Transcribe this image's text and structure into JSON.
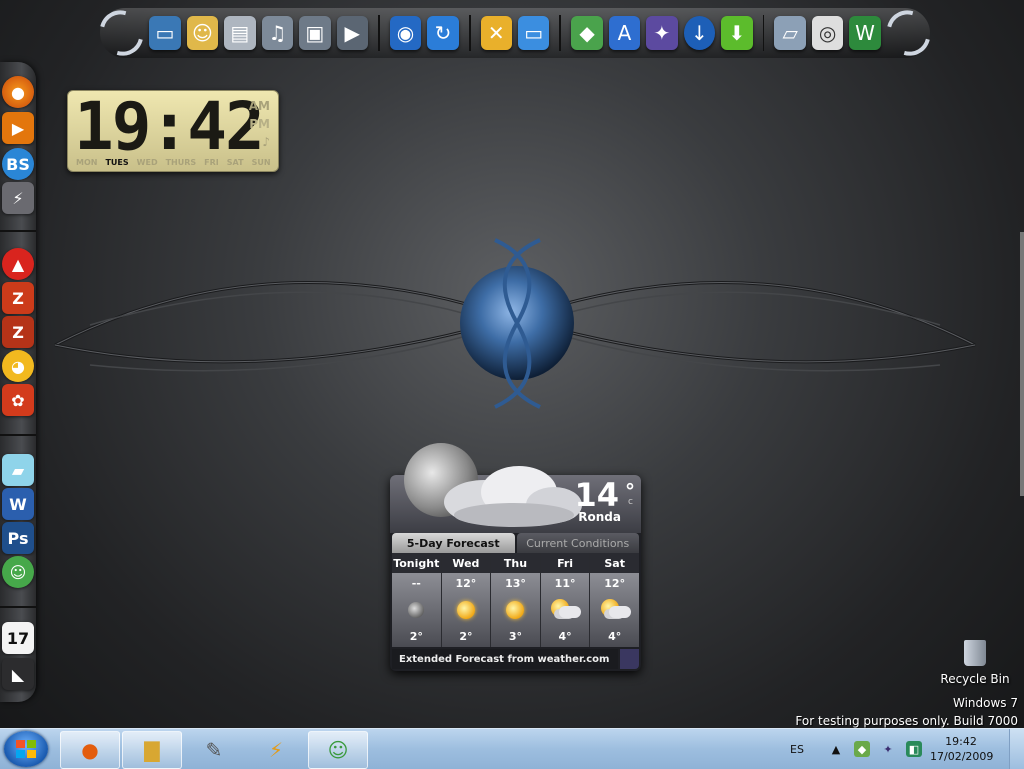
{
  "clock": {
    "time": "19:42",
    "am": "AM",
    "pm": "PM",
    "days": [
      "MON",
      "TUES",
      "WED",
      "THURS",
      "FRI",
      "SAT",
      "SUN"
    ],
    "active_day": "TUES"
  },
  "weather": {
    "temp": "14",
    "deg": "°",
    "unit": "c",
    "city": "Ronda",
    "tabs": [
      "5-Day Forecast",
      "Current Conditions"
    ],
    "forecast": [
      {
        "day": "Tonight",
        "high": "--",
        "low": "2°",
        "icon": "moon-icon"
      },
      {
        "day": "Wed",
        "high": "12°",
        "low": "2°",
        "icon": "sun-icon"
      },
      {
        "day": "Thu",
        "high": "13°",
        "low": "3°",
        "icon": "sun-icon"
      },
      {
        "day": "Fri",
        "high": "11°",
        "low": "4°",
        "icon": "partly-cloudy-icon"
      },
      {
        "day": "Sat",
        "high": "12°",
        "low": "4°",
        "icon": "partly-cloudy-icon"
      }
    ],
    "footer": "Extended Forecast from weather.com"
  },
  "desktop": {
    "recycle_bin": "Recycle Bin",
    "watermark_line1": "Windows  7",
    "watermark_line2": "For testing purposes only. Build 7000"
  },
  "taskbar": {
    "language": "ES",
    "time": "19:42",
    "date": "17/02/2009"
  },
  "top_dock": {
    "icons": [
      "swirl-logo-icon",
      "monitor-icon",
      "user-folder-icon",
      "documents-icon",
      "music-icon",
      "pictures-icon",
      "videos-icon",
      "media-center-icon",
      "sync-icon",
      "tools-icon",
      "remote-desktop-icon",
      "box-app-icon",
      "avant-icon",
      "trojan-icon",
      "download-circle-icon",
      "download-arrow-icon",
      "scanner-icon",
      "camera-icon",
      "wireless-icon",
      "swirl-logo-icon"
    ]
  },
  "left_dock": {
    "icons": [
      "firefox-icon",
      "media-player-icon",
      "bs-player-icon",
      "winamp-icon",
      "opera-icon",
      "filezilla-icon",
      "filezilla-server-icon",
      "duck-icon",
      "foxy-icon",
      "document-icon",
      "word-icon",
      "photoshop-icon",
      "messenger-icon",
      "calendar-icon",
      "app-icon"
    ],
    "calendar_day": "17"
  },
  "colors": {
    "taskbar": "#9dbedf",
    "clock_bg": "#e3dba4",
    "weather_bg": "#1e1f24"
  }
}
